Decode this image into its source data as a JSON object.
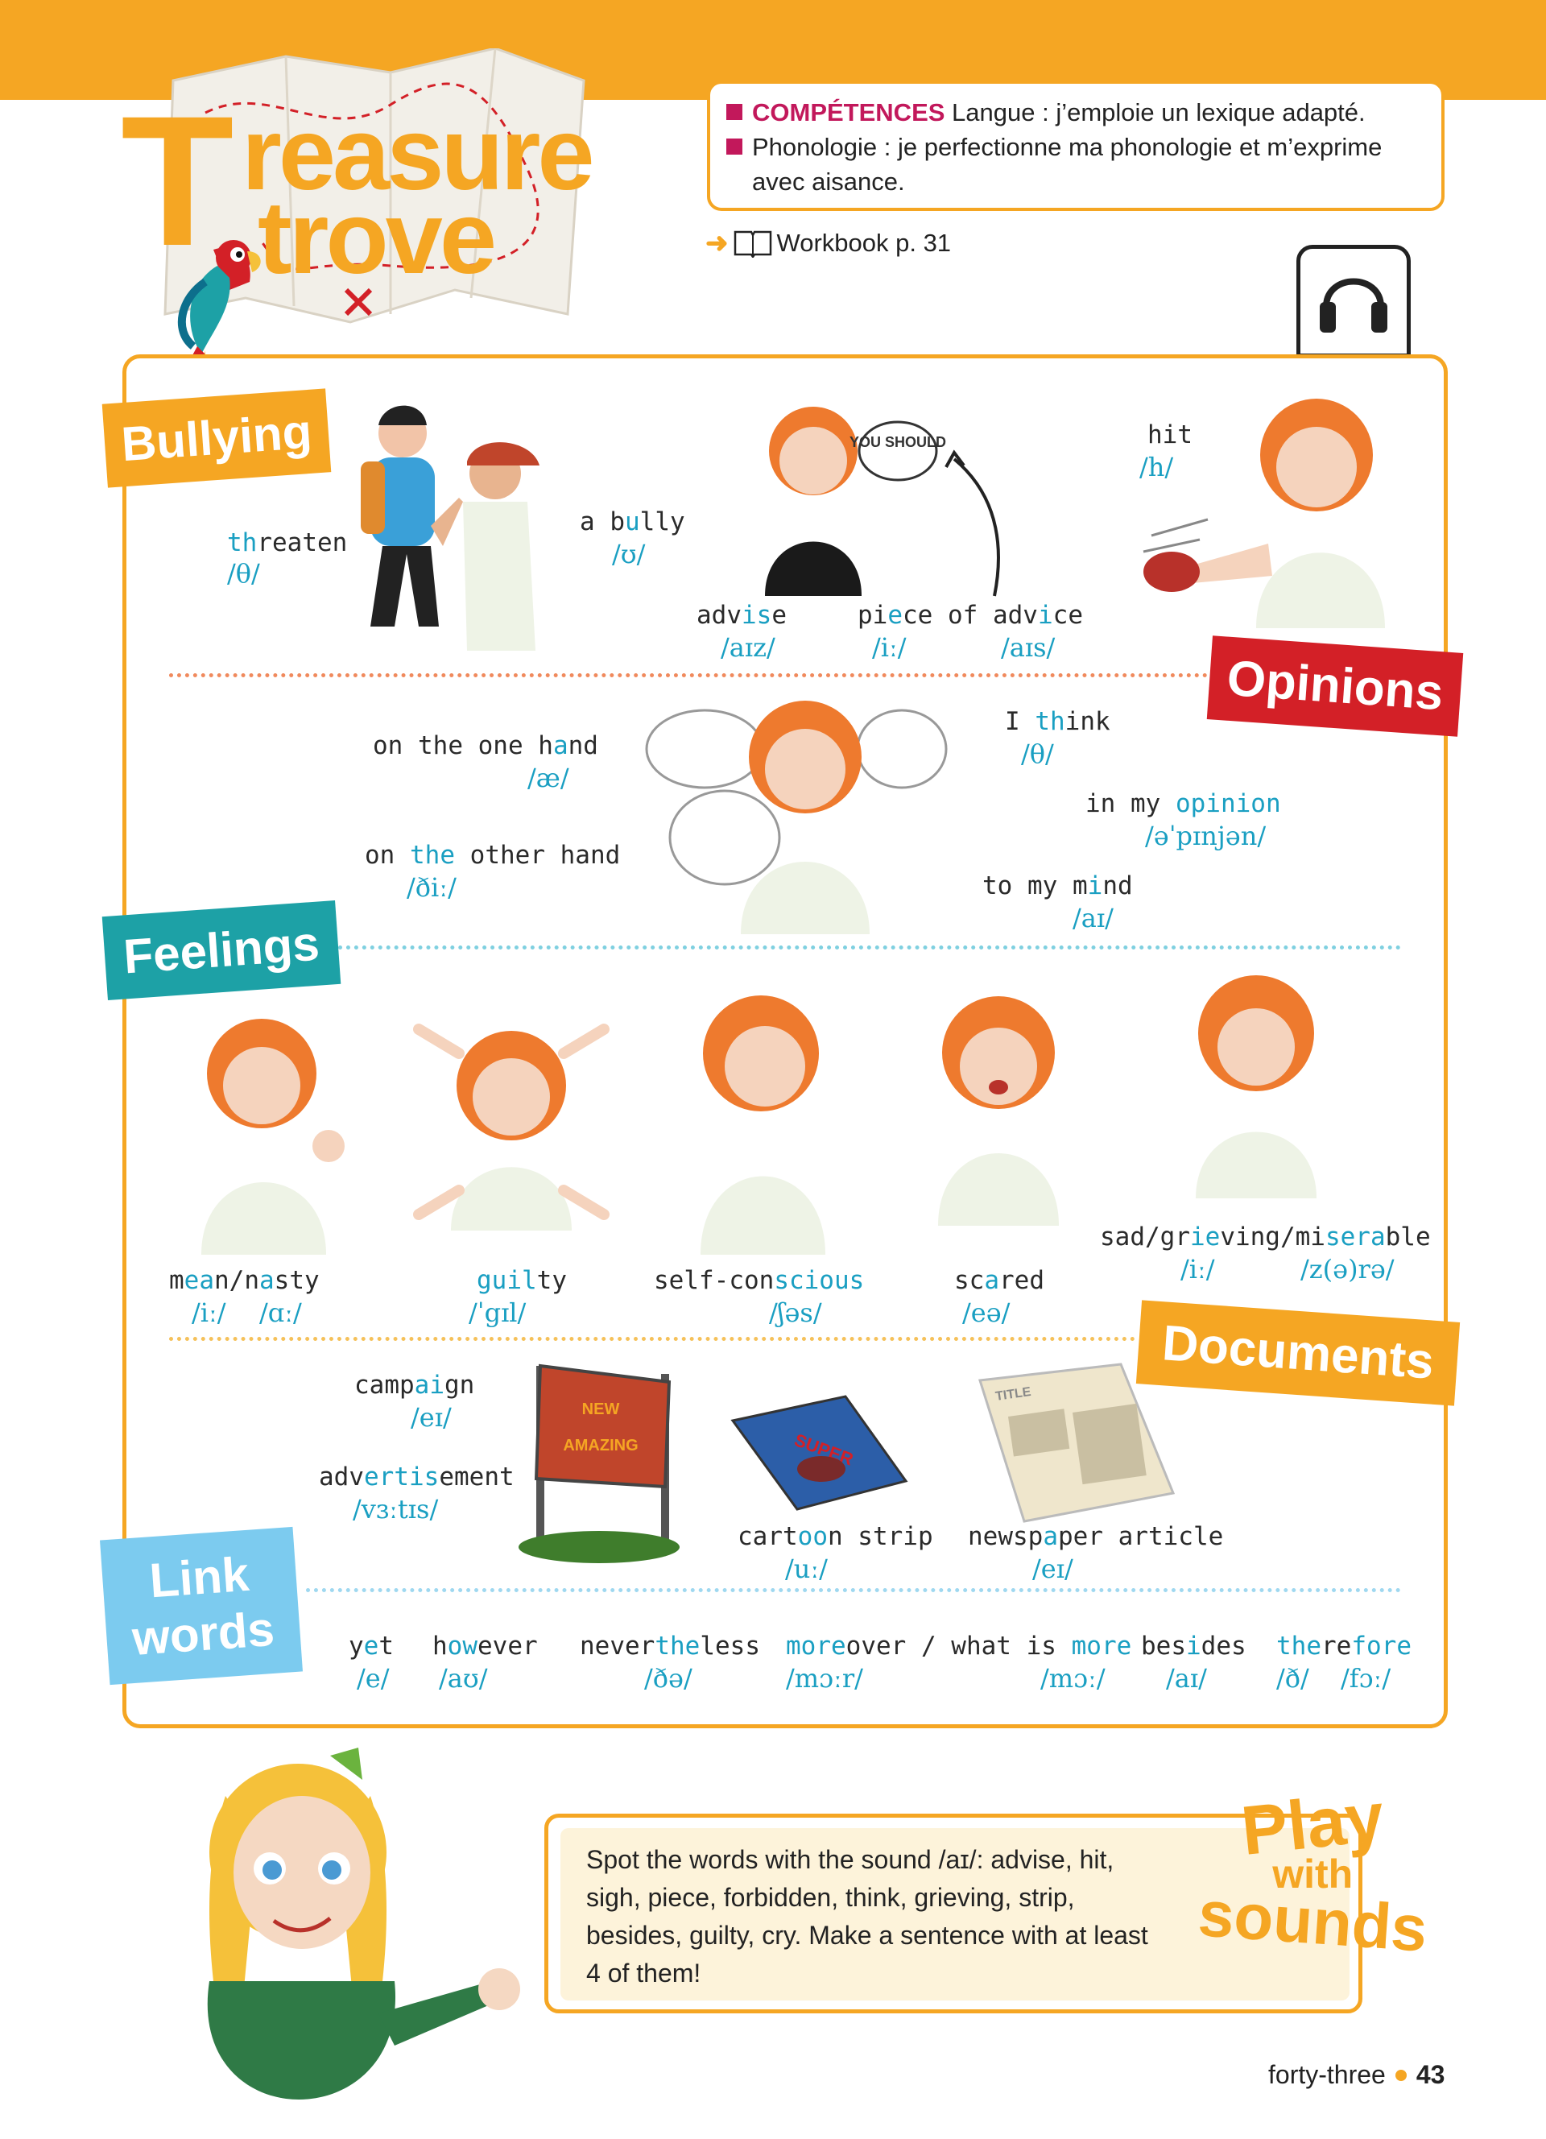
{
  "header": {
    "title_line1": "Treasure",
    "title_line1_initial": "T",
    "title_line1_rest": "reasure",
    "title_line2": "trove",
    "competences": {
      "label": "COMPÉTENCES",
      "line1": " Langue : j’emploie un lexique adapté.",
      "line2a": "Phonologie : je perfectionne ma phonologie et m’exprime",
      "line2b": "avec aisance."
    },
    "workbook": "Workbook p. 31",
    "audio_label": "audio"
  },
  "sections": {
    "bullying": "Bullying",
    "opinions": "Opinions",
    "feelings": "Feelings",
    "documents": "Documents",
    "link_words_1": "Link",
    "link_words_2": "words"
  },
  "bullying": {
    "threaten": {
      "hl": "th",
      "rest": "reaten",
      "ph": "/θ/"
    },
    "bully": {
      "pre": "a b",
      "hl": "u",
      "rest": "lly",
      "ph": "/ʊ/"
    },
    "advise": {
      "pre": "adv",
      "hl": "is",
      "rest": "e",
      "ph": "/aɪz/"
    },
    "piece": {
      "pre": "pi",
      "hl": "e",
      "mid": "ce of adv",
      "hl2": "i",
      "rest": "ce",
      "ph1": "/iː/",
      "ph2": "/aɪs/"
    },
    "hit": {
      "text": "hit",
      "ph": "/h/"
    },
    "bubble": "YOU SHOULD"
  },
  "opinions": {
    "one_hand": {
      "pre": "on the one h",
      "hl": "a",
      "rest": "nd",
      "ph": "/æ/"
    },
    "other_hand": {
      "pre": "on ",
      "hl": "the",
      "rest": " other hand",
      "ph": "/ðiː/"
    },
    "think": {
      "pre": "I ",
      "hl": "th",
      "rest": "ink",
      "ph": "/θ/"
    },
    "opinion": {
      "pre": "in my ",
      "hl": "opinion",
      "ph": "/əˈpɪnjən/"
    },
    "mind": {
      "pre": "to my m",
      "hl": "i",
      "rest": "nd",
      "ph": "/aɪ/"
    }
  },
  "feelings": {
    "mean": {
      "pre": "m",
      "hl": "ea",
      "mid": "n/n",
      "hl2": "a",
      "rest": "sty",
      "ph1": "/iː/",
      "ph2": "/ɑː/"
    },
    "guilty": {
      "hl": "guil",
      "rest": "ty",
      "ph": "/ˈgɪl/"
    },
    "self": {
      "pre": "self-con",
      "hl": "scious",
      "ph": "/ʃəs/"
    },
    "scared": {
      "pre": "sc",
      "hl": "a",
      "rest": "red",
      "ph": "/eə/"
    },
    "sad": {
      "pre": "sad/gr",
      "hl": "ie",
      "mid": "ving/mi",
      "hl2": "sera",
      "rest": "ble",
      "ph1": "/iː/",
      "ph2": "/z(ə)rə/"
    }
  },
  "documents": {
    "campaign": {
      "pre": "camp",
      "hl": "ai",
      "rest": "gn",
      "ph": "/eɪ/"
    },
    "advertisement": {
      "pre": "adv",
      "hl": "ertis",
      "rest": "ement",
      "ph": "/vɜːtɪs/"
    },
    "cartoon": {
      "pre": "cart",
      "hl": "oo",
      "rest": "n strip",
      "ph": "/uː/"
    },
    "newspaper": {
      "pre": "newsp",
      "hl": "a",
      "rest": "per article",
      "ph": "/eɪ/"
    },
    "billboard_text1": "NEW",
    "billboard_text2": "AMAZING",
    "comic_title": "SUPER",
    "newspaper_title": "TITLE"
  },
  "link_words": {
    "yet": {
      "pre": "y",
      "hl": "e",
      "rest": "t",
      "ph": "/e/"
    },
    "however": {
      "pre": "h",
      "hl": "ow",
      "rest": "ever",
      "ph": "/aʊ/"
    },
    "nevertheless": {
      "pre": "never",
      "hl": "the",
      "rest": "less",
      "ph": "/ðə/"
    },
    "moreover": {
      "hl": "more",
      "mid": "over / what is ",
      "hl2": "more",
      "ph1": "/mɔːr/",
      "ph2": "/mɔː/"
    },
    "besides": {
      "pre": "bes",
      "hl": "i",
      "rest": "des",
      "ph": "/aɪ/"
    },
    "therefore": {
      "hl": "the",
      "mid": "re",
      "hl2": "fore",
      "ph1": "/ð/",
      "ph2": "/fɔː/"
    }
  },
  "play": {
    "title1": "Play",
    "title2": "with",
    "title3": "sounds",
    "text": "Spot the words with the sound /aɪ/: advise, hit, sigh, piece, forbidden, think, grieving, strip, besides, guilty, cry. Make a sentence with at least 4 of them!"
  },
  "footer": {
    "words": "forty-three",
    "number": "43"
  },
  "colors": {
    "orange": "#f5a623",
    "red": "#d32027",
    "teal": "#1da1a6",
    "lightblue": "#7ccbef",
    "magenta": "#c2185b",
    "highlight": "#1a9fc2"
  }
}
